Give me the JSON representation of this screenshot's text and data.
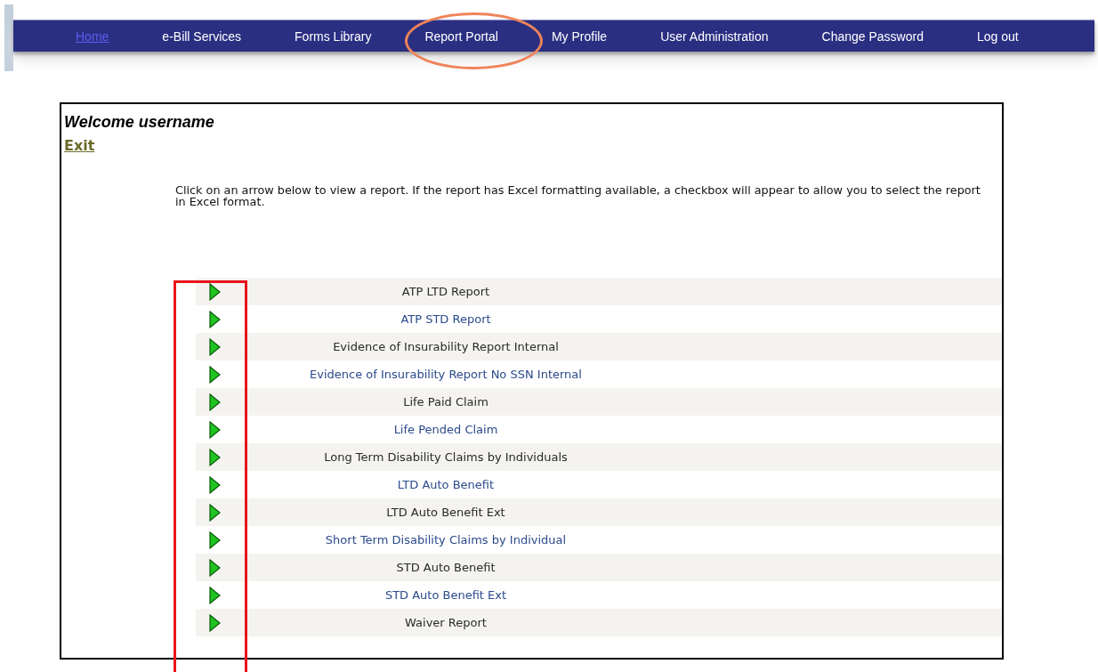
{
  "nav": [
    {
      "label": "Home",
      "kind": "link"
    },
    {
      "label": "e-Bill Services",
      "kind": "menu"
    },
    {
      "label": "Forms Library",
      "kind": "menu"
    },
    {
      "label": "Report Portal",
      "kind": "menu"
    },
    {
      "label": "My Profile",
      "kind": "menu"
    },
    {
      "label": "User Administration",
      "kind": "menu"
    },
    {
      "label": "Change Password",
      "kind": "menu"
    },
    {
      "label": "Log out",
      "kind": "menu"
    }
  ],
  "welcome": "Welcome username",
  "exit_link": "Exit",
  "instructions": "Click on an arrow below to view a report. If the report has Excel formatting available, a checkbox will appear to allow you to select the report in Excel format.",
  "reports": [
    "ATP LTD Report",
    "ATP STD Report",
    "Evidence of Insurability Report Internal",
    "Evidence of Insurability Report No SSN Internal",
    "Life Paid Claim",
    "Life Pended Claim",
    "Long Term Disability Claims by Individuals",
    "LTD Auto Benefit",
    "LTD Auto Benefit Ext",
    "Short Term Disability Claims by Individual",
    "STD Auto Benefit",
    "STD Auto Benefit Ext",
    "Waiver Report"
  ],
  "annotations": [
    {
      "kind": "ellipse",
      "color": "#f0845a"
    },
    {
      "kind": "rectangle",
      "color": "#e8141b"
    }
  ]
}
